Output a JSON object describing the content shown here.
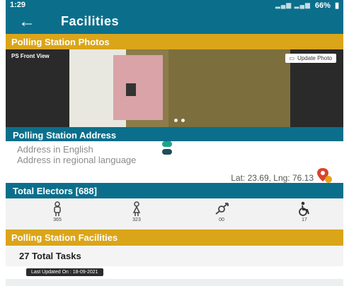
{
  "status_bar": {
    "time": "1:29",
    "battery": "66%"
  },
  "app_bar": {
    "title": "Facilities"
  },
  "photos_section": {
    "header": "Polling Station Photos",
    "photo_label": "PS Front View",
    "update_button": "Update Photo"
  },
  "address_section": {
    "header": "Polling Station Address",
    "english_label": "Address in English",
    "regional_label": "Address in regional language",
    "latlng": "Lat: 23.69, Lng: 76.13"
  },
  "electors_section": {
    "header": "Total Electors [688]",
    "stats": [
      {
        "icon": "male-icon",
        "value": "365"
      },
      {
        "icon": "female-icon",
        "value": "323"
      },
      {
        "icon": "third-gender-icon",
        "value": "00"
      },
      {
        "icon": "pwd-icon",
        "value": "17"
      }
    ]
  },
  "facilities_section": {
    "header": "Polling Station Facilities",
    "total_tasks": "27 Total Tasks",
    "last_updated": "Last Updated On : 18-09-2021"
  },
  "colors": {
    "primary": "#0b6f8c",
    "accent": "#dba51a",
    "toggle_on": "#1fa38a"
  }
}
